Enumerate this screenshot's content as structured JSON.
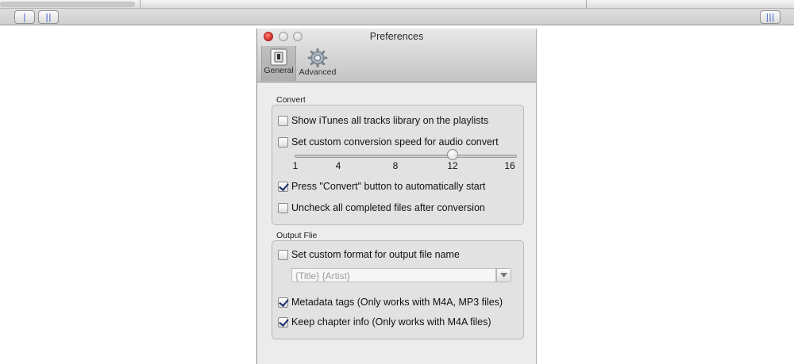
{
  "background": {
    "buttons": [
      "|",
      "||",
      "|||"
    ]
  },
  "window": {
    "title": "Preferences",
    "toolbar": [
      {
        "label": "General",
        "icon": "switch-icon",
        "selected": true
      },
      {
        "label": "Advanced",
        "icon": "gear-icon",
        "selected": false
      }
    ]
  },
  "convert": {
    "title": "Convert",
    "show_itunes": {
      "label": "Show iTunes all tracks library on the playlists",
      "checked": false
    },
    "custom_speed": {
      "label": "Set custom conversion speed for audio convert",
      "checked": false
    },
    "slider": {
      "ticks": [
        "1",
        "4",
        "8",
        "12",
        "16"
      ],
      "value": 12
    },
    "auto_start": {
      "label": "Press \"Convert\" button to automatically start",
      "checked": true
    },
    "uncheck_completed": {
      "label": "Uncheck all completed files after conversion",
      "checked": false
    }
  },
  "output": {
    "title": "Output Flie",
    "custom_format": {
      "label": "Set custom format for output file name",
      "checked": false
    },
    "format_placeholder": "{Title} {Artist}",
    "metadata": {
      "label": "Metadata tags (Only works with M4A, MP3 files)",
      "checked": true
    },
    "chapter": {
      "label": "Keep chapter info (Only works with M4A files)",
      "checked": true
    }
  },
  "colors": {
    "accent": "#3a5fcd",
    "check": "#1b2f6e",
    "close": "#d9332b"
  }
}
